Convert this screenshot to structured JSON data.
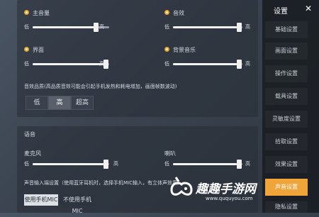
{
  "settings_top": {
    "main_volume": {
      "label": "主音量",
      "min": "低",
      "max": "高",
      "value": 0.82
    },
    "sfx": {
      "label": "音效",
      "min": "低",
      "max": "高",
      "value": 0.95
    },
    "ui": {
      "label": "界面",
      "min": "低",
      "max": "高",
      "value": 0.95
    },
    "bgm": {
      "label": "背景音乐",
      "min": "低",
      "max": "高",
      "value": 0.95
    },
    "quality_note": "音效品质(高品质音效可能会引起手机发热和耗电增加，画面帧数波动)",
    "quality_options": [
      "低",
      "高",
      "超高"
    ],
    "quality_selected": "高"
  },
  "voice": {
    "title": "语音",
    "mic": {
      "label": "麦克风",
      "min": "低",
      "max": "高",
      "value": 0.95
    },
    "speaker": {
      "label": "喇叭",
      "min": "低",
      "max": "高",
      "value": 0.95
    },
    "input_note": "声音输入端设置（使用蓝牙耳机时，选择手机MIC输入，有立体声效果）",
    "use_phone_mic": "使用手机MIC",
    "no_phone_mic": "不使用手机MIC"
  },
  "sidebar": {
    "title": "设置",
    "close": "✕",
    "items": [
      "基础设置",
      "画面设置",
      "操作设置",
      "载具设置",
      "灵敏度设置",
      "拾取设置",
      "效果设置",
      "声音设置",
      "隐私设置"
    ],
    "active": "声音设置"
  },
  "watermark": {
    "text": "趣趣手游网",
    "url": "www.ququyou.com"
  },
  "colors": {
    "accent": "#f0a53a",
    "icon": "#e6a42a"
  }
}
